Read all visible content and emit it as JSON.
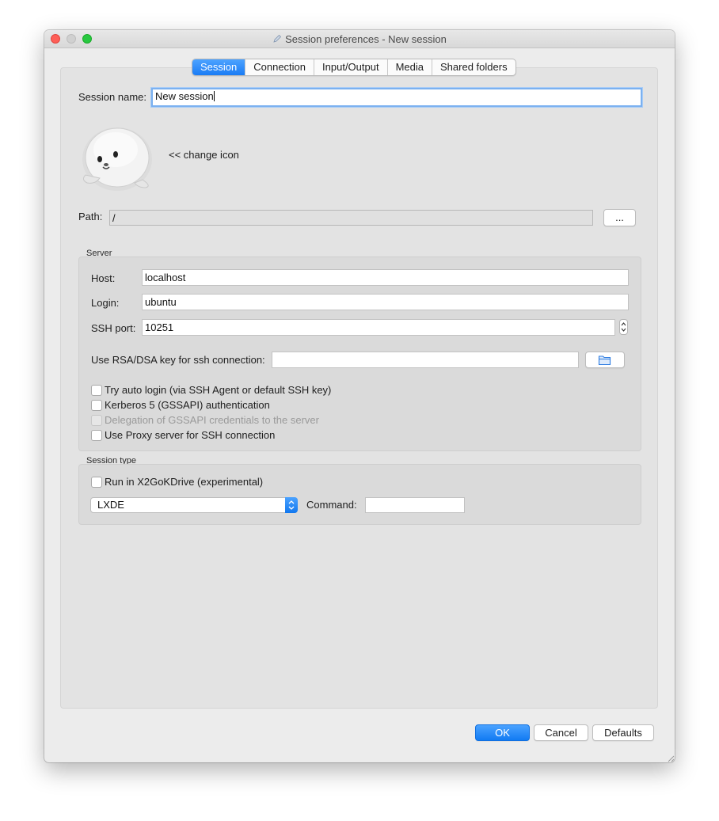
{
  "window": {
    "title": "Session preferences - New session"
  },
  "tabs": [
    {
      "label": "Session",
      "active": true
    },
    {
      "label": "Connection",
      "active": false
    },
    {
      "label": "Input/Output",
      "active": false
    },
    {
      "label": "Media",
      "active": false
    },
    {
      "label": "Shared folders",
      "active": false
    }
  ],
  "session": {
    "name_label": "Session name:",
    "name_value": "New session",
    "change_icon_label": "<< change icon",
    "path_label": "Path:",
    "path_value": "/",
    "path_button": "..."
  },
  "server": {
    "group_title": "Server",
    "host_label": "Host:",
    "host_value": "localhost",
    "login_label": "Login:",
    "login_value": "ubuntu",
    "port_label": "SSH port:",
    "port_value": "10251",
    "key_label": "Use RSA/DSA key for ssh connection:",
    "key_value": "",
    "checkboxes": [
      {
        "label": "Try auto login (via SSH Agent or default SSH key)",
        "checked": false,
        "enabled": true
      },
      {
        "label": "Kerberos 5 (GSSAPI) authentication",
        "checked": false,
        "enabled": true
      },
      {
        "label": "Delegation of GSSAPI credentials to the server",
        "checked": false,
        "enabled": false
      },
      {
        "label": "Use Proxy server for SSH connection",
        "checked": false,
        "enabled": true
      }
    ]
  },
  "session_type": {
    "group_title": "Session type",
    "x2gokdrive_label": "Run in X2GoKDrive (experimental)",
    "x2gokdrive_checked": false,
    "type_value": "LXDE",
    "command_label": "Command:",
    "command_value": ""
  },
  "buttons": {
    "ok": "OK",
    "cancel": "Cancel",
    "defaults": "Defaults"
  },
  "colors": {
    "accent": "#1a7cf5",
    "close": "#fe5f57",
    "minimize": "#d0d0d0",
    "maximize": "#28c840"
  },
  "icons": [
    "session-icon-seal",
    "folder-icon",
    "pencil-icon"
  ]
}
